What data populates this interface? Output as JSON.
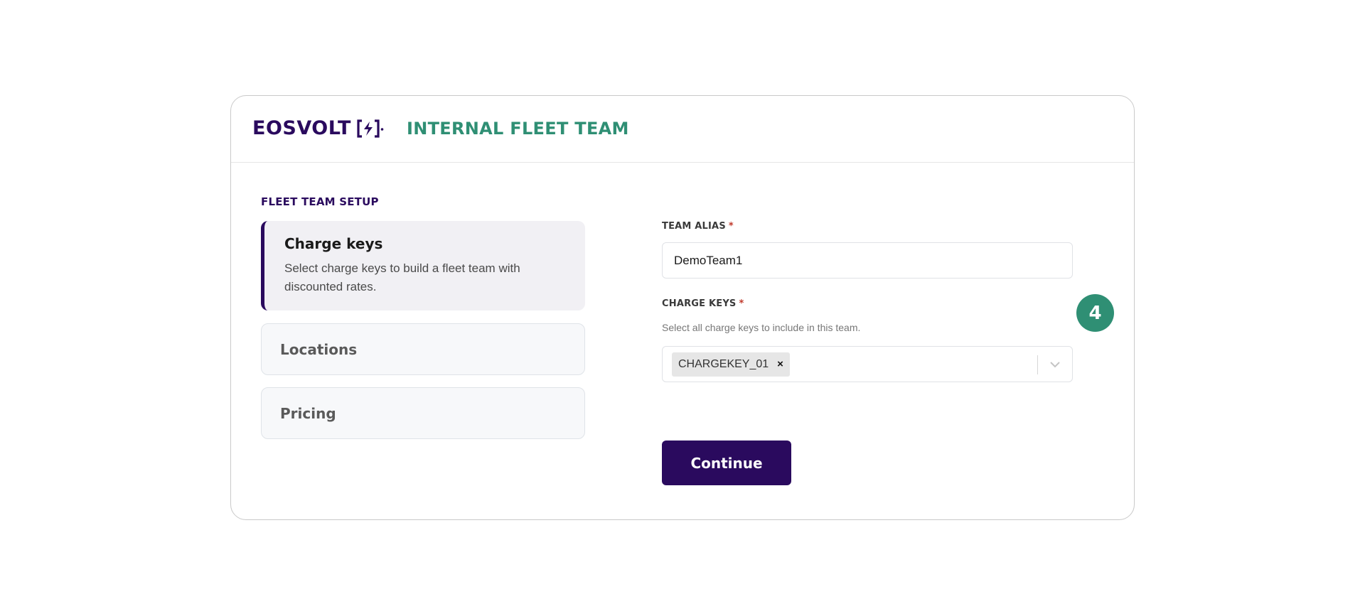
{
  "header": {
    "logo_text": "EOSVOLT",
    "title": "INTERNAL FLEET TEAM"
  },
  "sidebar": {
    "section_title": "FLEET TEAM SETUP",
    "steps": [
      {
        "title": "Charge keys",
        "description": "Select charge keys to build a fleet team with discounted rates.",
        "active": true
      },
      {
        "title": "Locations",
        "active": false
      },
      {
        "title": "Pricing",
        "active": false
      }
    ]
  },
  "form": {
    "team_alias": {
      "label": "TEAM ALIAS",
      "required_mark": "*",
      "value": "DemoTeam1"
    },
    "charge_keys": {
      "label": "CHARGE KEYS",
      "required_mark": "*",
      "helper": "Select all charge keys to include in this team.",
      "selected": [
        "CHARGEKEY_01"
      ],
      "remove_glyph": "×"
    },
    "continue_label": "Continue"
  },
  "annotation": {
    "step_number": "4"
  },
  "colors": {
    "brand_purple": "#2a0a5e",
    "accent_green": "#2f8f74",
    "required_red": "#c0392b"
  },
  "icons": {
    "logo_mark": "lightning-bolt-bracket-icon",
    "chevron": "chevron-down-icon",
    "remove": "close-icon"
  }
}
